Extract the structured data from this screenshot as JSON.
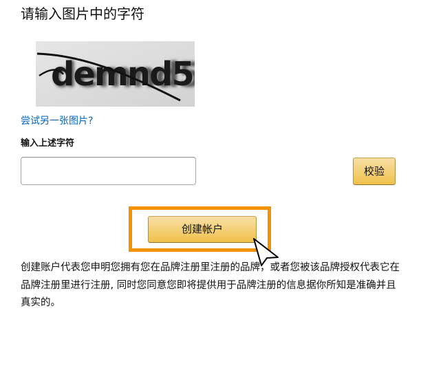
{
  "page": {
    "title": "请输入图片中的字符"
  },
  "captcha": {
    "text": "demnd5",
    "alt_link": "尝试另一张图片?"
  },
  "form": {
    "input_label": "输入上述字符",
    "input_value": "",
    "verify_button": "校验"
  },
  "actions": {
    "create_account_button": "创建帐户"
  },
  "disclaimer": {
    "text": "创建账户代表您申明您拥有您在品牌注册里注册的品牌，或者您被该品牌授权代表它在品牌注册里进行注册, 同时您同意您即将提供用于品牌注册的信息据你所知是准确并且真实的。"
  },
  "colors": {
    "link": "#0066c0",
    "button_top": "#f7dfa5",
    "button_bottom": "#f0c14b",
    "highlight": "#f39200"
  },
  "icons": {
    "cursor": "arrow-cursor-icon"
  }
}
